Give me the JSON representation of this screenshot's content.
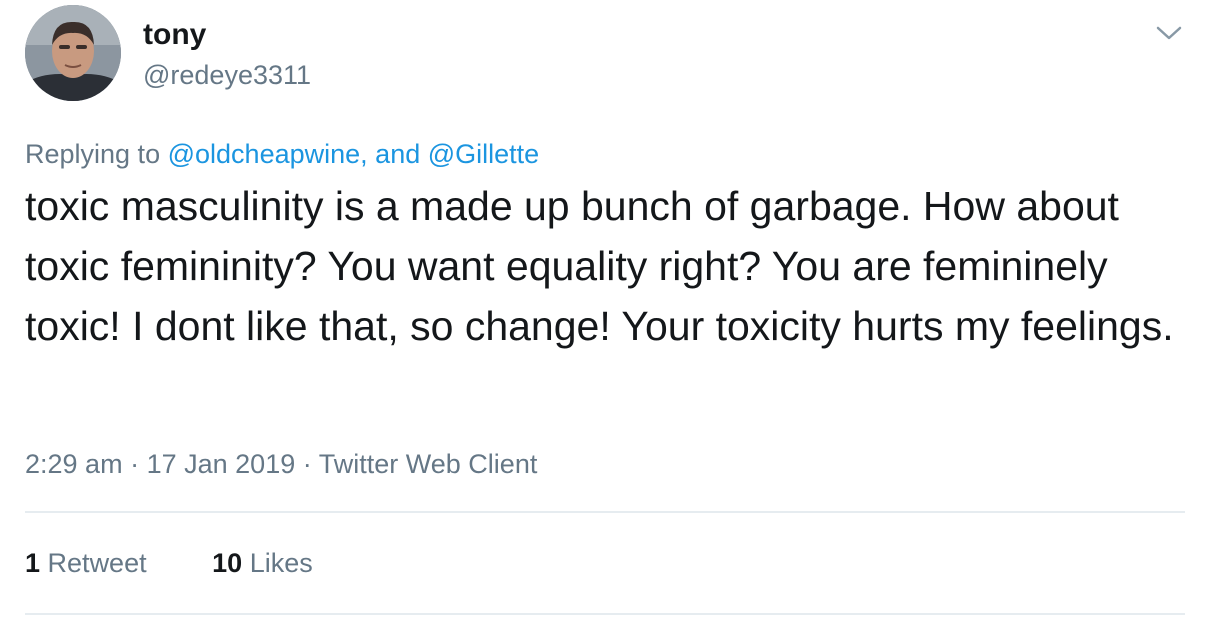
{
  "user": {
    "display_name": "tony",
    "handle": "@redeye3311",
    "avatar_icon": "user-photo-avatar"
  },
  "menu_icon": "chevron-down-icon",
  "reply": {
    "prefix": "Replying to",
    "mention1": "@oldcheapwine,",
    "conjunction": "and",
    "mention2": "@Gillette"
  },
  "tweet": {
    "text": "toxic masculinity is a made up bunch of garbage. How about toxic femininity? You want equality right? You are femininely toxic! I dont like that, so change! Your toxicity hurts my feelings."
  },
  "meta": {
    "time": "2:29 am",
    "separator": "·",
    "date": "17 Jan 2019",
    "client": "Twitter Web Client"
  },
  "stats": {
    "retweets": {
      "count": "1",
      "label": "Retweet"
    },
    "likes": {
      "count": "10",
      "label": "Likes"
    }
  },
  "colors": {
    "text": "#14171a",
    "secondary": "#657786",
    "link": "#1b95e0",
    "divider": "#e6ecf0"
  }
}
